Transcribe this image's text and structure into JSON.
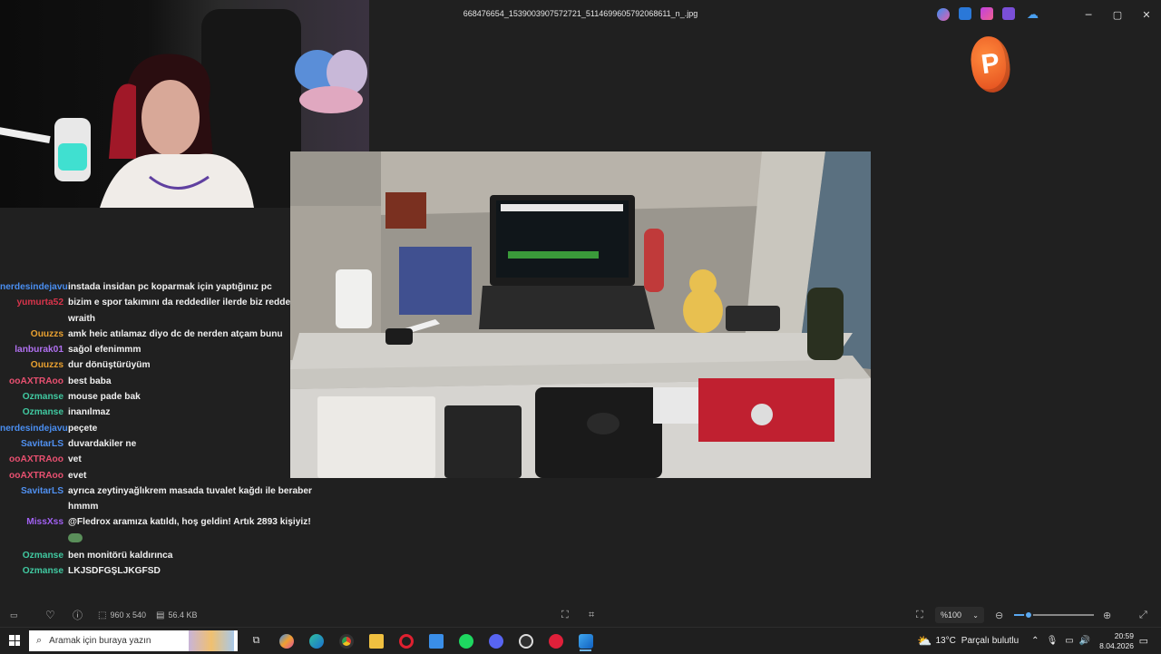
{
  "window": {
    "title": "668476654_1539003907572721_5114699605792068611_n_.jpg",
    "minimize": "─",
    "maximize": "▢",
    "close": "✕"
  },
  "chat": [
    {
      "user": "nerdesindejavu",
      "color": "#4a8ef0",
      "msg": "instada insidan pc koparmak için yaptığınız pc"
    },
    {
      "user": "yumurta52",
      "color": "#d8344b",
      "msg": "bizim e spor takımını da reddediler ilerde biz reddecez wraith"
    },
    {
      "user": "Ouuzzs",
      "color": "#e8a030",
      "msg": "amk heic atılamaz diyo dc de nerden atçam bunu"
    },
    {
      "user": "lanburak01",
      "color": "#b070f0",
      "msg": "sağol efenimmm"
    },
    {
      "user": "Ouuzzs",
      "color": "#e8a030",
      "msg": "dur dönüştürüyüm"
    },
    {
      "user": "ooAXTRAoo",
      "color": "#e85070",
      "msg": "best baba"
    },
    {
      "user": "Ozmanse",
      "color": "#40c8a0",
      "msg": "mouse pade bak"
    },
    {
      "user": "Ozmanse",
      "color": "#40c8a0",
      "msg": "inanılmaz"
    },
    {
      "user": "nerdesindejavu",
      "color": "#4a8ef0",
      "msg": "peçete"
    },
    {
      "user": "SavitarLS",
      "color": "#5090f0",
      "msg": "duvardakiler ne"
    },
    {
      "user": "ooAXTRAoo",
      "color": "#e85070",
      "msg": "vet"
    },
    {
      "user": "ooAXTRAoo",
      "color": "#e85070",
      "msg": "evet"
    },
    {
      "user": "SavitarLS",
      "color": "#5090f0",
      "msg": "ayrıca zeytinyağlıkrem masada tuvalet kağdı ile beraber hmmm"
    },
    {
      "user": "MissXss",
      "color": "#a060f0",
      "msg": "@Fledrox aramıza katıldı, hoş geldin! Artık 2893 kişiyiz!",
      "emote": true
    },
    {
      "user": "Ozmanse",
      "color": "#40c8a0",
      "msg": "ben monitörü kaldırınca"
    },
    {
      "user": "Ozmanse",
      "color": "#40c8a0",
      "msg": "LKJSDFGŞLJKGFSD"
    }
  ],
  "viewer_bar": {
    "dimensions": "960 x 540",
    "file_size": "56.4 KB",
    "zoom": "%100",
    "zoom_fraction": 0.18
  },
  "taskbar": {
    "search_placeholder": "Aramak için buraya yazın",
    "weather_temp": "13°C",
    "weather_desc": "Parçalı bulutlu",
    "time": "20:59",
    "date": "8.04.2026"
  }
}
